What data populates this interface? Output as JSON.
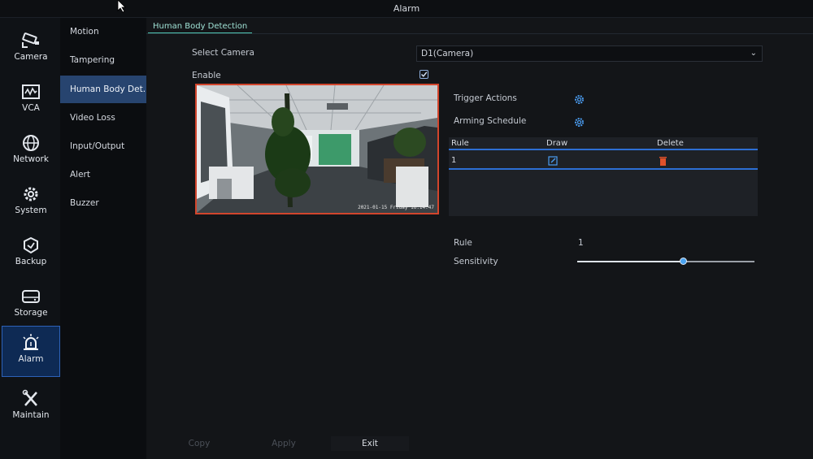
{
  "window": {
    "title": "Alarm"
  },
  "left_nav": [
    {
      "label": "Camera",
      "icon": "camera-icon"
    },
    {
      "label": "VCA",
      "icon": "vca-icon"
    },
    {
      "label": "Network",
      "icon": "network-globe-icon"
    },
    {
      "label": "System",
      "icon": "system-gear-icon"
    },
    {
      "label": "Backup",
      "icon": "backup-icon"
    },
    {
      "label": "Storage",
      "icon": "storage-drive-icon"
    },
    {
      "label": "Alarm",
      "icon": "alarm-siren-icon",
      "active": true
    },
    {
      "label": "Maintain",
      "icon": "maintain-tools-icon"
    }
  ],
  "sub_nav": [
    {
      "label": "Motion"
    },
    {
      "label": "Tampering"
    },
    {
      "label": "Human Body Det...",
      "active": true
    },
    {
      "label": "Video Loss"
    },
    {
      "label": "Input/Output"
    },
    {
      "label": "Alert"
    },
    {
      "label": "Buzzer"
    }
  ],
  "tab": {
    "label": "Human Body Detection"
  },
  "form": {
    "select_camera_label": "Select Camera",
    "select_camera_value": "D1(Camera)",
    "enable_label": "Enable",
    "enable_checked": true,
    "trigger_actions_label": "Trigger Actions",
    "arming_schedule_label": "Arming Schedule"
  },
  "video": {
    "osd": "2021-01-15 Friday 16:14:47"
  },
  "rules_table": {
    "headers": {
      "rule": "Rule",
      "draw": "Draw",
      "delete": "Delete"
    },
    "rows": [
      {
        "rule": "1"
      }
    ]
  },
  "rule_detail": {
    "rule_label": "Rule",
    "rule_value": "1",
    "sensitivity_label": "Sensitivity",
    "sensitivity_fraction": 0.6
  },
  "buttons": {
    "copy": "Copy",
    "apply": "Apply",
    "exit": "Exit"
  },
  "colors": {
    "accent_blue": "#2d6fd4",
    "tab_green": "#4fc8b4",
    "video_border": "#d2452c",
    "delete_red": "#e0512a"
  }
}
